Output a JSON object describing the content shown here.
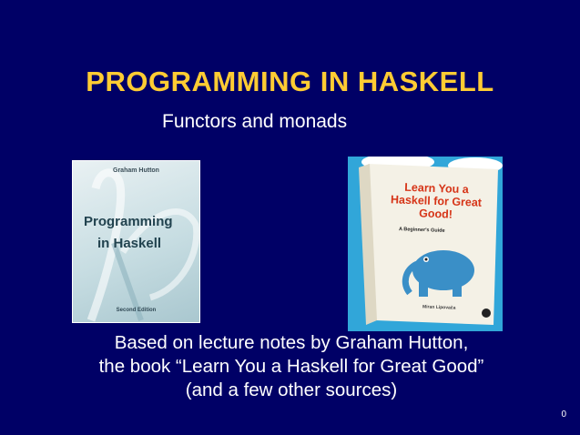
{
  "slide": {
    "title": "PROGRAMMING IN HASKELL",
    "subtitle": "Functors and monads",
    "credits": [
      "Based on lecture notes by Graham Hutton,",
      "the book “Learn You a Haskell for Great Good”",
      "(and a few other sources)"
    ],
    "page_number": "0"
  },
  "book1": {
    "author": "Graham Hutton",
    "title_line1": "Programming",
    "title_line2": "in Haskell",
    "edition": "Second Edition"
  },
  "book2": {
    "title": "Learn You a Haskell for Great Good!",
    "subtitle": "A Beginner's Guide",
    "author": "Miran Lipovača"
  },
  "colors": {
    "background": "#000066",
    "title": "#FFCC33",
    "text": "#FFFFFF"
  }
}
